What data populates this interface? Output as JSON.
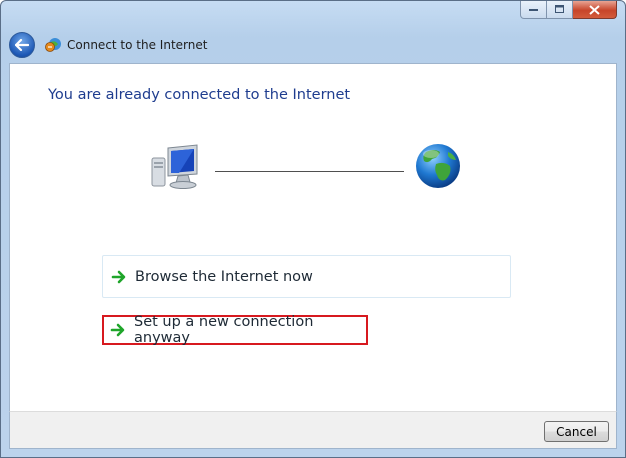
{
  "window": {
    "title": "Connect to the Internet",
    "caption_buttons": [
      "minimize",
      "maximize",
      "close"
    ]
  },
  "content": {
    "heading": "You are already connected to the Internet",
    "icons": [
      "computer-icon",
      "globe-icon"
    ],
    "options": [
      {
        "label": "Browse the Internet now",
        "icon": "green-arrow-icon"
      },
      {
        "label": "Set up a new connection anyway",
        "icon": "green-arrow-icon",
        "highlighted": true
      }
    ]
  },
  "footer": {
    "cancel_label": "Cancel"
  },
  "colors": {
    "heading": "#1f3d8f",
    "highlight_border": "#d7191f",
    "arrow": "#1fa52a",
    "frame": "#bcd3ec"
  }
}
